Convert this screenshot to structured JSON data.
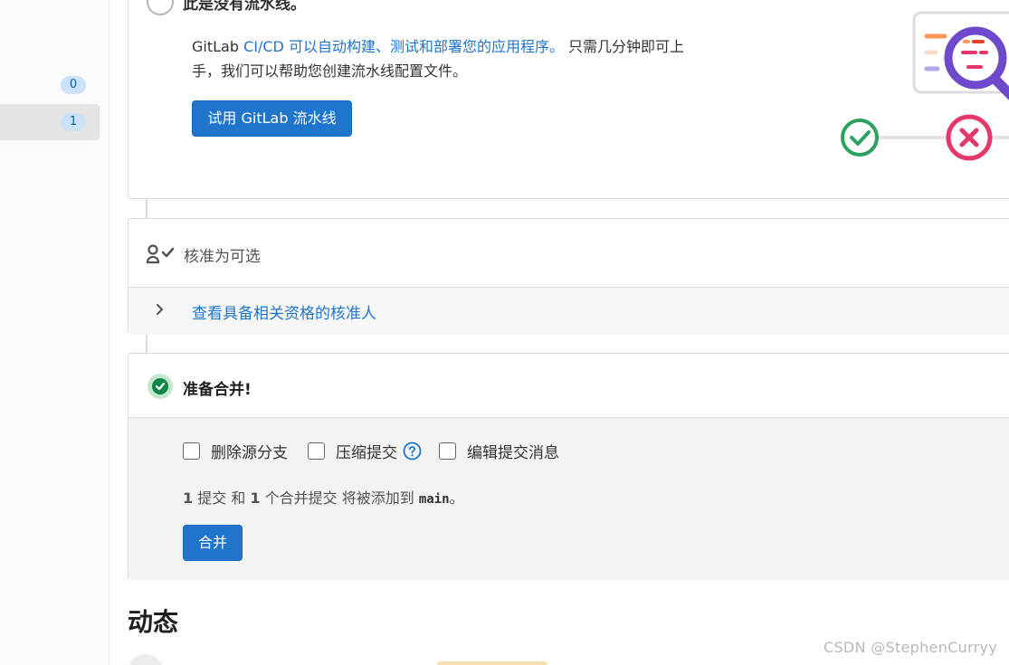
{
  "sidebar": {
    "counts": [
      "0",
      "1"
    ]
  },
  "pipeline": {
    "title_partial": "此是没有流水线。",
    "desc_prefix": "GitLab ",
    "desc_link": "CI/CD 可以自动构建、测试和部署您的应用程序。",
    "desc_line1_rest": " 只需几分钟即可上",
    "desc_line2": "手，我们可以帮助您创建流水线配置文件。",
    "try_button": "试用 GitLab 流水线"
  },
  "approvals": {
    "status": "核准为可选",
    "view_approvers": "查看具备相关资格的核准人"
  },
  "merge": {
    "ready": "准备合并!",
    "options": [
      "删除源分支",
      "压缩提交",
      "编辑提交消息"
    ],
    "commit_count": "1",
    "commit_word": " 提交 和 ",
    "merge_commit_count": "1",
    "merge_commit_text": " 个合并提交 将被添加到 ",
    "target_branch": "main",
    "period": "。",
    "merge_button": "合并"
  },
  "activity": {
    "title": "动态"
  },
  "watermark": "CSDN @StephenCurryy",
  "colors": {
    "primary": "#1f75cb",
    "success": "#108548",
    "danger": "#dd2b0e",
    "badge_bg": "#cbe2f9"
  }
}
